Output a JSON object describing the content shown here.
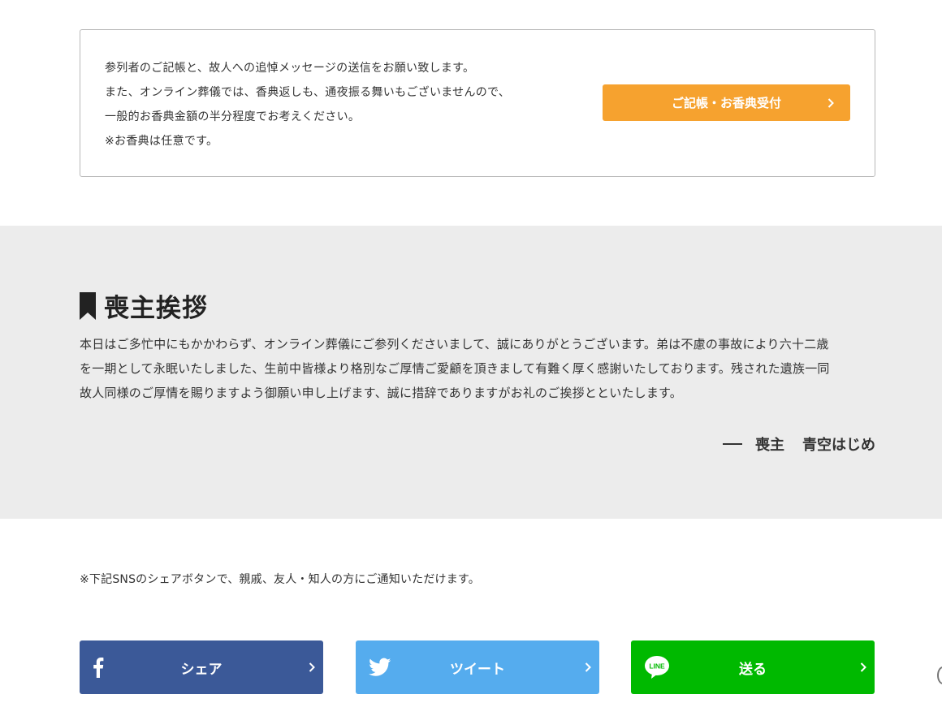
{
  "notice": {
    "lines": [
      "参列者のご記帳と、故人への追悼メッセージの送信をお願い致します。",
      "また、オンライン葬儀では、香典返しも、通夜振る舞いもございませんので、",
      "一般的お香典金額の半分程度でお考えください。",
      "※お香典は任意です。"
    ],
    "button_label": "ご記帳・お香典受付",
    "button_icon": "chevron-right-icon"
  },
  "greeting": {
    "heading": "喪主挨拶",
    "heading_icon": "bookmark-icon",
    "lines": [
      "本日はご多忙中にもかかわらず、オンライン葬儀にご参列くださいまして、誠にありがとうございます。弟は不慮の事故により六十二歳",
      "を一期として永眠いたしました、生前中皆様より格別なご厚情ご愛顧を頂きまして有難く厚く感謝いたしております。残された遺族一同",
      "故人同様のご厚情を賜りますよう御願い申し上げます、誠に措辞でありますがお礼のご挨拶とといたします。"
    ],
    "signature_role": "喪主",
    "signature_name": "青空はじめ"
  },
  "sns": {
    "note": "※下記SNSのシェアボタンで、親戚、友人・知人の方にご通知いただけます。",
    "buttons": [
      {
        "label": "シェア",
        "icon": "facebook-icon",
        "color": "#3b5998"
      },
      {
        "label": "ツイート",
        "icon": "twitter-icon",
        "color": "#55acee"
      },
      {
        "label": "送る",
        "icon": "line-icon",
        "color": "#00b900"
      }
    ]
  },
  "colors": {
    "accent_orange": "#f6a22f",
    "section_bg": "#ececec",
    "border": "#b8b8b8"
  }
}
